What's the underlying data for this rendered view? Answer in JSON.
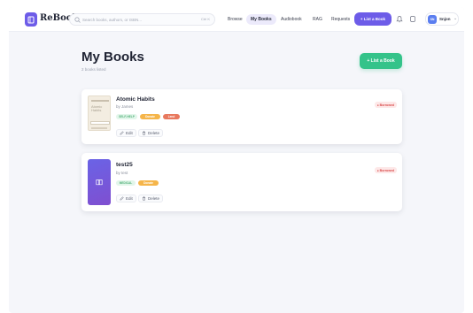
{
  "app": {
    "logo_text": "ReBook",
    "logo_icon": "book-icon"
  },
  "search": {
    "placeholder": "Search books, authors, or ISBN...",
    "value": "",
    "shortcut": "Ctrl K",
    "icon": "search-icon"
  },
  "nav": {
    "items": [
      {
        "label": "Browse",
        "active": false
      },
      {
        "label": "My Books",
        "active": true
      },
      {
        "label": "Audiobook",
        "active": false
      },
      {
        "label": "RAG",
        "active": false
      },
      {
        "label": "Requests",
        "active": false
      }
    ]
  },
  "header_actions": {
    "list_button": "+ List a Book",
    "bell_icon": "bell-icon",
    "info_icon": "info-icon"
  },
  "user": {
    "initials": "SN",
    "name": "Snjon",
    "chevron": "⌄"
  },
  "page": {
    "title": "My Books",
    "subtitle": "2 books listed",
    "list_button": "+ List a Book"
  },
  "books": [
    {
      "title": "Atomic Habits",
      "author": "by James",
      "genre": "SELF-HELP",
      "status": "Donate",
      "extra_tag": "Lend",
      "state": "Borrowed",
      "cover_text": "Atomic Habits",
      "edit_label": "Edit",
      "delete_label": "Delete"
    },
    {
      "title": "test25",
      "author": "by test",
      "genre": "MEDICAL",
      "status": "Donate",
      "state": "Borrowed",
      "edit_label": "Edit",
      "delete_label": "Delete"
    }
  ],
  "colors": {
    "accent": "#6d5ce8",
    "primary_green": "#34c38a",
    "borrowed_red": "#d94a4a",
    "background": "#f5f6fa"
  }
}
